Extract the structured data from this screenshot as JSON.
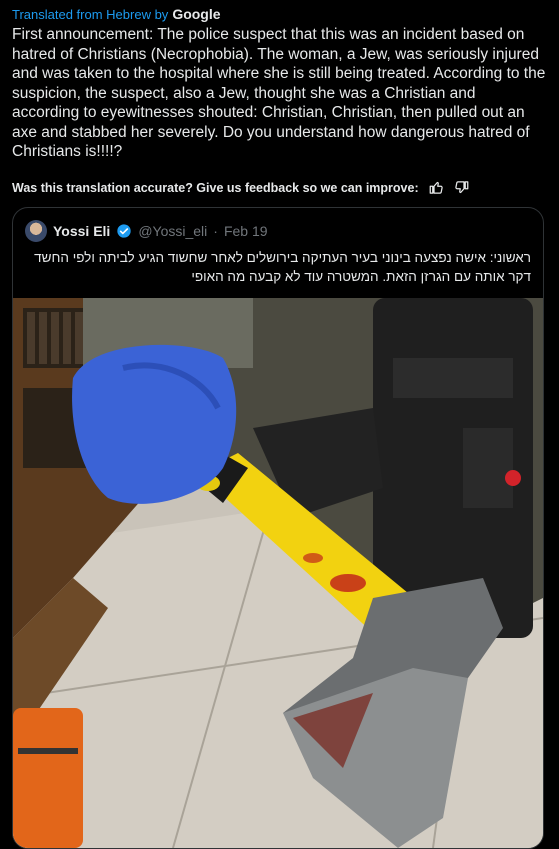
{
  "translation": {
    "prefix": "Translated from Hebrew by",
    "provider": "Google"
  },
  "tweet": {
    "text": "First announcement: The police suspect that this was an incident based on hatred of Christians (Necrophobia). The woman, a Jew, was seriously injured and was taken to the hospital where she is still being treated. According to the suspicion, the suspect, also a Jew, thought she was a Christian and according to eyewitnesses shouted: Christian, Christian, then pulled out an axe and stabbed her severely. Do you understand how dangerous hatred of Christians is!!!!?"
  },
  "feedback": {
    "question": "Was this translation accurate? Give us feedback so we can improve:",
    "icons": [
      "thumbs-up-icon",
      "thumbs-down-icon"
    ]
  },
  "quote": {
    "name": "Yossi Eli",
    "handle": "@Yossi_eli",
    "separator": "·",
    "date": "Feb 19",
    "text": "ראשוני: אישה נפצעה בינוני בעיר העתיקה בירושלים לאחר שחשוד הגיע לביתה ולפי החשד דקר אותה עם הגרזן הזאת. המשטרה עוד לא קבעה מה האופי"
  },
  "colors": {
    "link": "#1d9bf0",
    "text": "#e7e9ea",
    "muted": "#71767b",
    "border": "#2f3336",
    "background": "#000000"
  }
}
